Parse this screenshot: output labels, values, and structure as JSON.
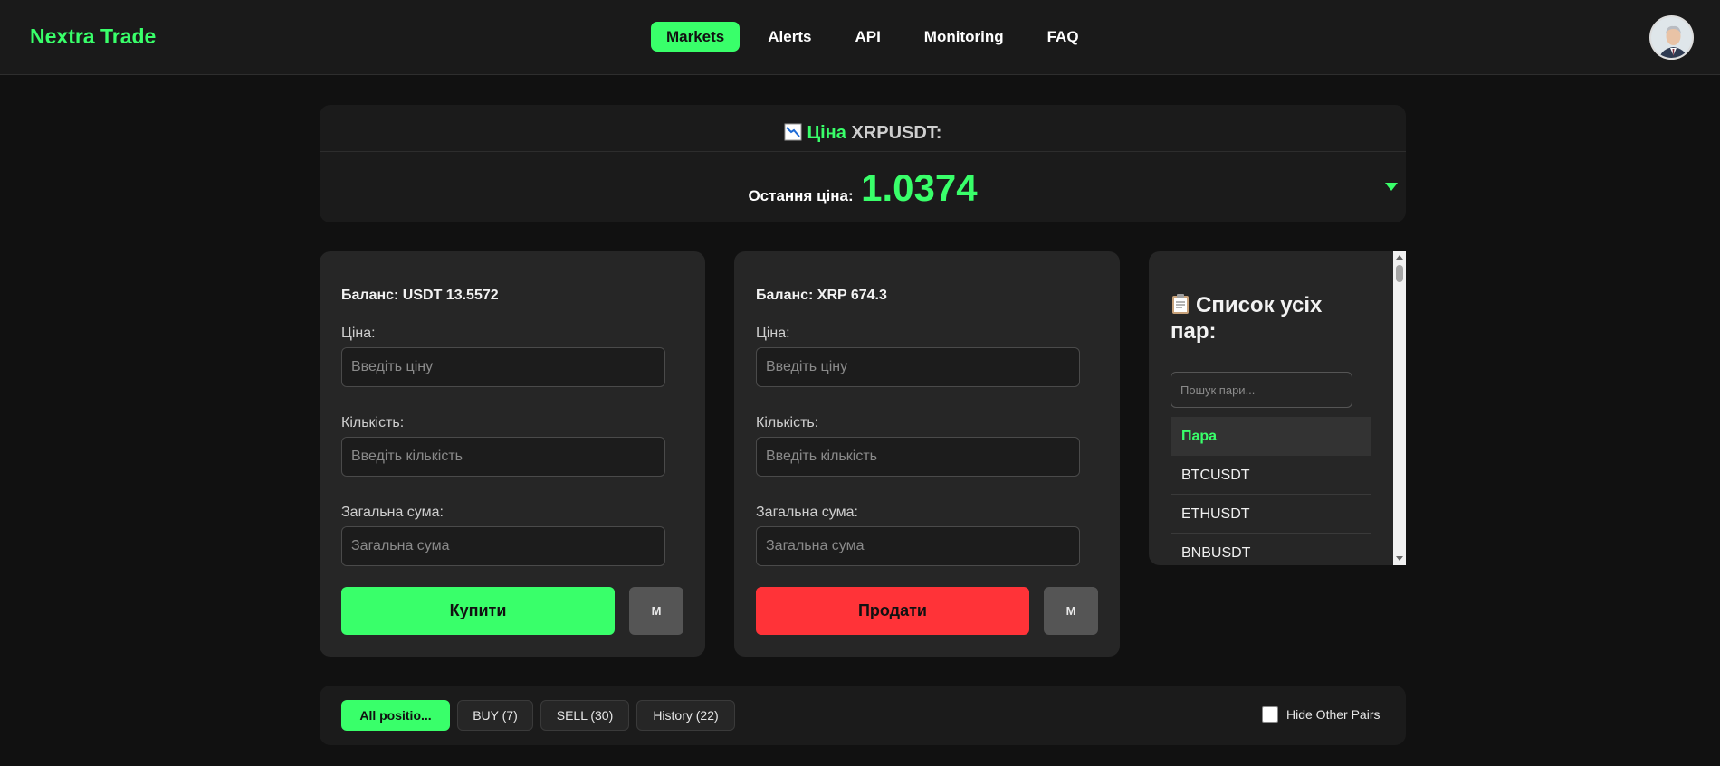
{
  "app": {
    "logo": "Nextra Trade"
  },
  "nav": [
    {
      "label": "Markets",
      "active": true
    },
    {
      "label": "Alerts",
      "active": false
    },
    {
      "label": "API",
      "active": false
    },
    {
      "label": "Monitoring",
      "active": false
    },
    {
      "label": "FAQ",
      "active": false
    }
  ],
  "price": {
    "icon": "chart-down-icon",
    "title_label": "Ціна",
    "symbol": "XRPUSDT:",
    "last_label": "Остання ціна:",
    "last_value": "1.0374"
  },
  "buy": {
    "balance": "Баланс: USDT 13.5572",
    "price_label": "Ціна:",
    "price_placeholder": "Введіть ціну",
    "qty_label": "Кількість:",
    "qty_placeholder": "Введіть кількість",
    "total_label": "Загальна сума:",
    "total_placeholder": "Загальна сума",
    "action": "Купити",
    "m": "M"
  },
  "sell": {
    "balance": "Баланс: XRP 674.3",
    "price_label": "Ціна:",
    "price_placeholder": "Введіть ціну",
    "qty_label": "Кількість:",
    "qty_placeholder": "Введіть кількість",
    "total_label": "Загальна сума:",
    "total_placeholder": "Загальна сума",
    "action": "Продати",
    "m": "M"
  },
  "pairs": {
    "icon": "clipboard-icon",
    "title": "Список усіх пар:",
    "search_placeholder": "Пошук пари...",
    "header": "Пара",
    "rows": [
      "BTCUSDT",
      "ETHUSDT",
      "BNBUSDT"
    ]
  },
  "positions": {
    "tabs": [
      "All positio...",
      "BUY (7)",
      "SELL (30)",
      "History (22)"
    ],
    "hide_label": "Hide Other Pairs"
  },
  "colors": {
    "accent": "#39ff6a",
    "sell": "#ff3338",
    "background": "#111111"
  }
}
